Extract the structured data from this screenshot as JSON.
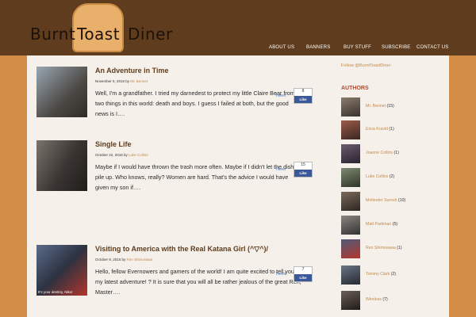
{
  "logo": {
    "word1": "Burnt",
    "word2": "Toast",
    "word3": "Diner"
  },
  "nav": [
    "ABOUT US",
    "BANNERS",
    "BUY STUFF",
    "SUBSCRIBE",
    "CONTACT US"
  ],
  "posts": [
    {
      "title": "An Adventure in Time",
      "date": "November 5, 2015 by",
      "author": "Mr. Bennet",
      "excerpt": "Well, I'm a grandfather. I tried my darnedest to protect my little Claire Bear from two things in this world: death and boys. I guess I failed at both, but the good news is I….",
      "tweet": "Tweet",
      "likes": "8",
      "like_label": "Like",
      "thumb_caption": ""
    },
    {
      "title": "Single Life",
      "date": "October 22, 2015 by",
      "author": "Luke Collins",
      "excerpt": "Maybe if I would have thrown the trash more often. Maybe if I didn't let the dishes pile up. Who knows, really? Women are hard. That's the advice I would have given my son if….",
      "tweet": "Tweet",
      "likes": "15",
      "like_label": "Like",
      "thumb_caption": ""
    },
    {
      "title": "Visiting to America with the Real Katana Girl (^▽^)/",
      "date": "October 9, 2015 by",
      "author": "Ren Shimosawa",
      "excerpt": "Hello, fellow Evernowers and gamers of the world! I am quite excited to tell you of my latest adventure! ? It is sure that you will all be rather jealous of the great Ren, Master….",
      "tweet": "Tweet",
      "likes": "7",
      "like_label": "Like",
      "thumb_caption": "It's your destiny, Niko!"
    }
  ],
  "sidebar": {
    "follow": "Follow @BurntToastDiner",
    "authors_heading": "AUTHORS",
    "authors": [
      {
        "name": "Mr. Bennet",
        "count": "(15)"
      },
      {
        "name": "Erica Kravid",
        "count": "(1)"
      },
      {
        "name": "Joanne Collins",
        "count": "(1)"
      },
      {
        "name": "Luke Collins",
        "count": "(2)"
      },
      {
        "name": "Mohinder Suresh",
        "count": "(10)"
      },
      {
        "name": "Matt Parkman",
        "count": "(5)"
      },
      {
        "name": "Ren Shimosawa",
        "count": "(1)"
      },
      {
        "name": "Tommy Clark",
        "count": "(2)"
      },
      {
        "name": "Wireless",
        "count": "(7)"
      }
    ]
  },
  "colors": {
    "header": "#5e3c1d",
    "background": "#d28c45",
    "accent": "#c28a4b",
    "title": "#5e3c1d",
    "authors_heading": "#b8472b"
  }
}
